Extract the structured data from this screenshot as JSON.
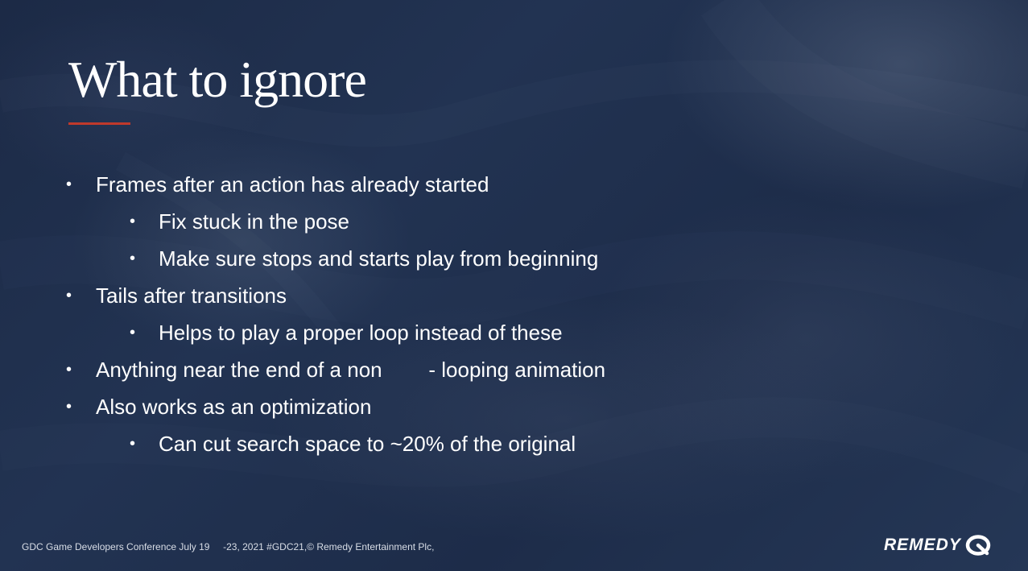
{
  "slide": {
    "title": "What to ignore",
    "bullets": [
      {
        "level": 1,
        "text": "Frames after an action has already started"
      },
      {
        "level": 2,
        "text": "Fix stuck in the pose"
      },
      {
        "level": 2,
        "text": "Make sure stops and starts play from beginning"
      },
      {
        "level": 1,
        "text": "Tails after transitions"
      },
      {
        "level": 2,
        "text": "Helps to play a proper loop instead of these"
      },
      {
        "level": 1,
        "text": "Anything near the end of a non        - looping animation"
      },
      {
        "level": 1,
        "text": "Also works as an optimization"
      },
      {
        "level": 2,
        "text": "Can cut search space to ~20% of the original"
      }
    ],
    "bullet_glyph": "•",
    "footer": "GDC Game Developers Conference July 19     -23, 2021 #GDC21,© Remedy Entertainment Plc,",
    "logo": {
      "text": "REMEDY",
      "icon": "remedy-logo-icon"
    }
  },
  "colors": {
    "background": "#1f2f4c",
    "title_rule": "#c0392b",
    "text": "#ffffff"
  }
}
